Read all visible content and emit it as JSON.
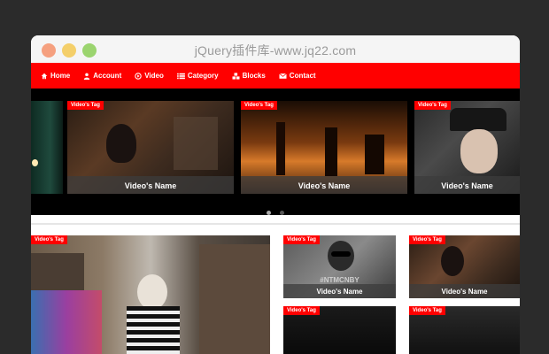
{
  "window": {
    "title": "jQuery插件库-www.jq22.com"
  },
  "nav": {
    "items": [
      {
        "label": "Home",
        "icon": "home-icon"
      },
      {
        "label": "Account",
        "icon": "user-icon"
      },
      {
        "label": "Video",
        "icon": "play-circle-icon"
      },
      {
        "label": "Category",
        "icon": "list-icon"
      },
      {
        "label": "Blocks",
        "icon": "cubes-icon"
      },
      {
        "label": "Contact",
        "icon": "envelope-icon"
      }
    ]
  },
  "slider": {
    "slides": [
      {
        "tag": "Video's Tag",
        "name": "Video's Name"
      },
      {
        "tag": "Video's Tag",
        "name": "Video's Name"
      },
      {
        "tag": "Video's Tag",
        "name": "Video's Name"
      }
    ],
    "pager": {
      "count": 2,
      "active": 1
    }
  },
  "grid": {
    "big": {
      "tag": "Video's Tag"
    },
    "small": [
      {
        "tag": "Video's Tag",
        "name": "Video's Name",
        "overlay": "#NTMCNBY"
      },
      {
        "tag": "Video's Tag",
        "name": "Video's Name"
      },
      {
        "tag": "Video's Tag"
      },
      {
        "tag": "Video's Tag"
      }
    ]
  },
  "colors": {
    "accent": "#ff0000",
    "page_bg": "#2b2b2b",
    "slider_bg": "#000000"
  }
}
